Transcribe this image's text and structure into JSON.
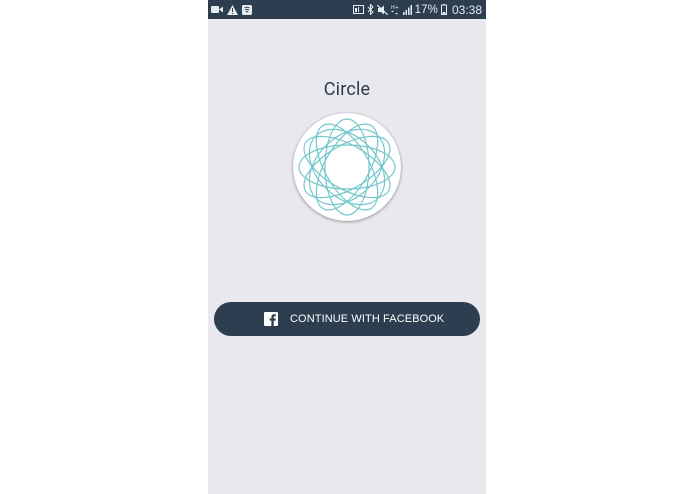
{
  "status_bar": {
    "left_icons": [
      "video-camera-icon",
      "warning-icon",
      "shield-icon"
    ],
    "right_icons": [
      "cast-icon",
      "bluetooth-icon",
      "mute-icon",
      "network-icon",
      "signal-icon",
      "battery-icon"
    ],
    "battery_percent": "17%",
    "time": "03:38",
    "network_type": "H+",
    "background_color": "#2c3e50"
  },
  "app": {
    "title": "Circle",
    "background_color": "#e8e8ee",
    "logo_icon": "circle-logo-icon",
    "logo_color": "#6cc5c9"
  },
  "login": {
    "facebook_button_label": "CONTINUE WITH FACEBOOK",
    "facebook_icon": "facebook-icon",
    "button_color": "#2c3e50"
  }
}
